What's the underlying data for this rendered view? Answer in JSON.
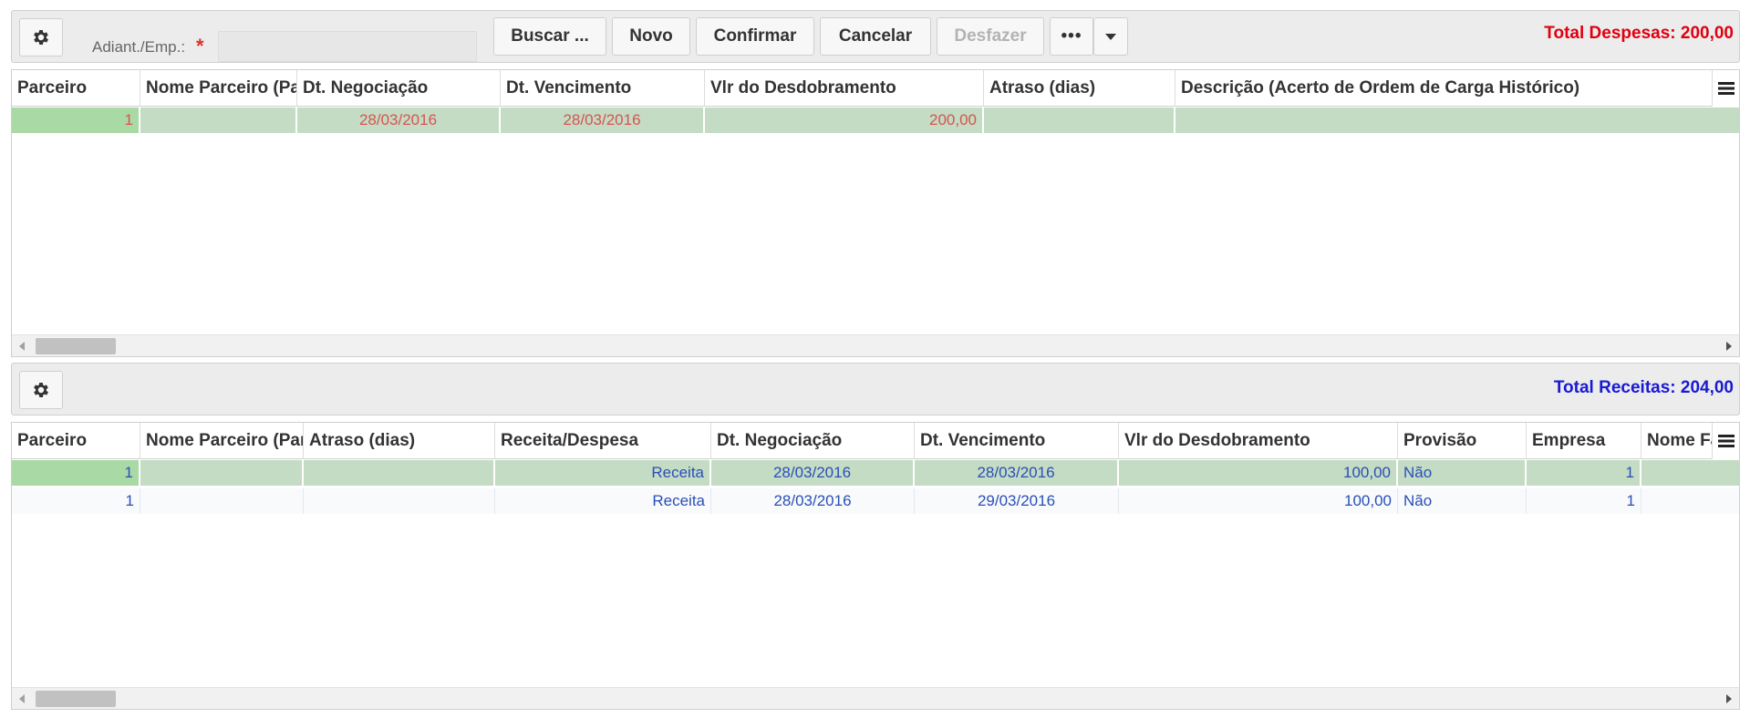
{
  "toolbar1": {
    "field_label": "Adiant./Emp.:",
    "required_mark": "*",
    "field_value": "",
    "buttons": {
      "buscar": "Buscar ...",
      "novo": "Novo",
      "confirmar": "Confirmar",
      "cancelar": "Cancelar",
      "desfazer": "Desfazer",
      "more": "•••"
    },
    "total_label": "Total Despesas: 200,00",
    "total_color": "#e0000f"
  },
  "grid1": {
    "columns": [
      "Parceiro",
      "Nome Parceiro (Parceiro)",
      "Dt. Negociação",
      "Dt. Vencimento",
      "Vlr do Desdobramento",
      "Atraso (dias)",
      "Descrição (Acerto de Ordem de Carga Histórico)"
    ],
    "rows": [
      {
        "parceiro": "1",
        "nome": "",
        "dt_neg": "28/03/2016",
        "dt_venc": "28/03/2016",
        "vlr": "200,00",
        "atraso": "",
        "descricao": ""
      }
    ],
    "text_color": "#d9534f"
  },
  "toolbar2": {
    "total_label": "Total Receitas: 204,00",
    "total_color": "#1a1ad4"
  },
  "grid2": {
    "columns": [
      "Parceiro",
      "Nome Parceiro (Parceiro)",
      "Atraso (dias)",
      "Receita/Despesa",
      "Dt. Negociação",
      "Dt. Vencimento",
      "Vlr do Desdobramento",
      "Provisão",
      "Empresa",
      "Nome Fantasia"
    ],
    "rows": [
      {
        "parceiro": "1",
        "nome": "",
        "atraso": "",
        "tipo": "Receita",
        "dt_neg": "28/03/2016",
        "dt_venc": "28/03/2016",
        "vlr": "100,00",
        "provisao": "Não",
        "empresa": "1",
        "fantasia": ""
      },
      {
        "parceiro": "1",
        "nome": "",
        "atraso": "",
        "tipo": "Receita",
        "dt_neg": "28/03/2016",
        "dt_venc": "29/03/2016",
        "vlr": "100,00",
        "provisao": "Não",
        "empresa": "1",
        "fantasia": ""
      }
    ],
    "text_color": "#2a4fb7"
  },
  "icons": [
    "gear-icon",
    "menu-icon",
    "chevron-down-icon",
    "scroll-left-icon",
    "scroll-right-icon"
  ]
}
